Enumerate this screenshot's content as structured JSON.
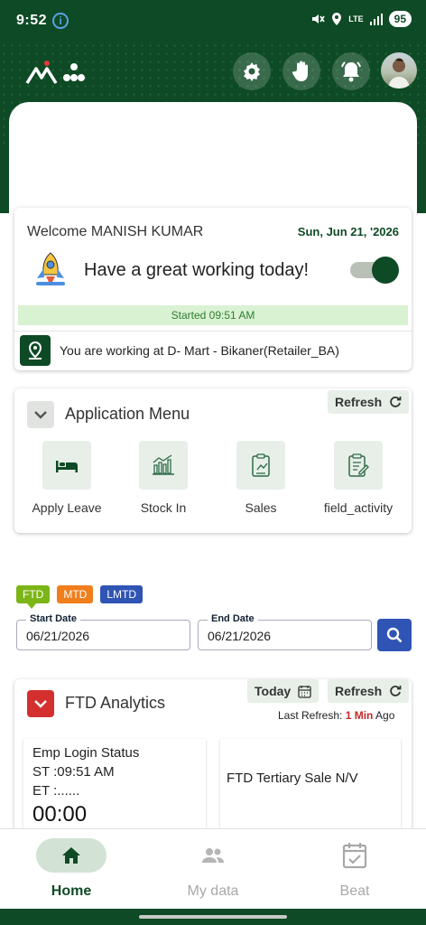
{
  "status_bar": {
    "time": "9:52",
    "info_glyph": "i",
    "network": "LTE",
    "battery": "95"
  },
  "header": {
    "logo_icon": "company-logo",
    "buttons": [
      "settings-icon",
      "hand-icon",
      "notification-bell-icon"
    ],
    "avatar": "user-avatar"
  },
  "welcome": {
    "name": "Welcome MANISH KUMAR",
    "date": "Sun, Jun 21, '2026",
    "greeting": "Have a great working today!",
    "toggle_on": true,
    "started": "Started 09:51 AM",
    "location": "You are working at D- Mart - Bikaner(Retailer_BA)"
  },
  "app_menu": {
    "title": "Application Menu",
    "refresh": "Refresh",
    "items": [
      {
        "label": "Apply Leave",
        "icon": "bed-icon"
      },
      {
        "label": "Stock In",
        "icon": "bar-chart-icon"
      },
      {
        "label": "Sales",
        "icon": "clipboard-sales-icon"
      },
      {
        "label": "field_activity",
        "icon": "clipboard-edit-icon"
      }
    ]
  },
  "period_chips": [
    {
      "label": "FTD",
      "color": "#7cb518"
    },
    {
      "label": "MTD",
      "color": "#f07e1c"
    },
    {
      "label": "LMTD",
      "color": "#2f54b4"
    }
  ],
  "date_range": {
    "start_label": "Start Date",
    "start_value": "06/21/2026",
    "end_label": "End Date",
    "end_value": "06/21/2026"
  },
  "ftd_analytics": {
    "title": "FTD Analytics",
    "today_btn": "Today",
    "refresh": "Refresh",
    "last_refresh_prefix": "Last Refresh: ",
    "last_refresh_value": "1 Min",
    "last_refresh_suffix": " Ago",
    "login_status": {
      "title": "Emp Login Status",
      "st": "ST :09:51 AM",
      "et": "ET :......",
      "duration": "00:00"
    },
    "tertiary_sale": "FTD Tertiary Sale N/V"
  },
  "bottom_nav": [
    {
      "label": "Home",
      "icon": "home-icon",
      "active": true
    },
    {
      "label": "My data",
      "icon": "people-icon",
      "active": false
    },
    {
      "label": "Beat",
      "icon": "calendar-check-icon",
      "active": false
    }
  ],
  "colors": {
    "brand": "#0e4a25",
    "accent_blue": "#2f54b4",
    "danger": "#d32f2f"
  }
}
